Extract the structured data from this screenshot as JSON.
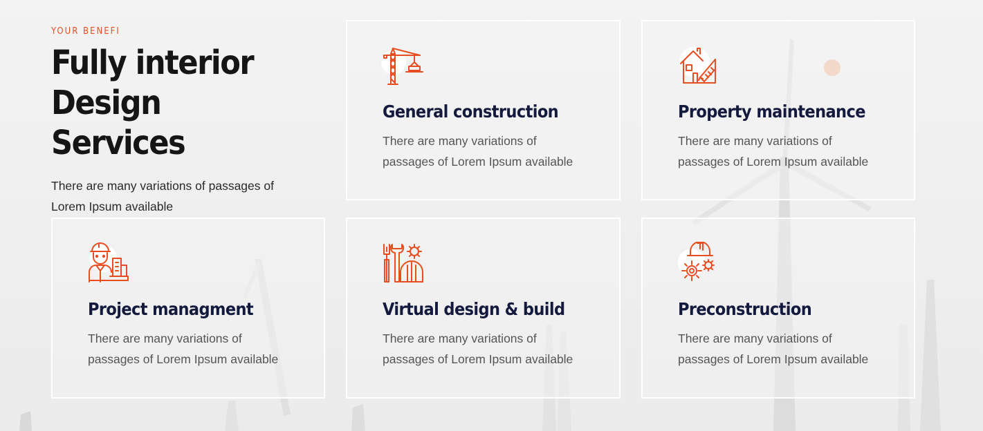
{
  "section": {
    "eyebrow": "YOUR BENEFI",
    "title_line1": "Fully interior",
    "title_line2": "Design Services",
    "description": "There are many variations of passages of Lorem Ipsum available"
  },
  "colors": {
    "accent": "#e84d1f",
    "title_dark": "#151515",
    "card_title": "#131a3d",
    "body_text": "#555555",
    "card_border": "#ffffff"
  },
  "services": [
    {
      "title": "General construction",
      "description": "There are many variations of passages of Lorem Ipsum available",
      "icon": "crane-icon"
    },
    {
      "title": "Property maintenance",
      "description": "There are many variations of passages of Lorem Ipsum available",
      "icon": "house-blueprint-icon"
    },
    {
      "title": "Project managment",
      "description": "There are many variations of passages of Lorem Ipsum available",
      "icon": "engineer-icon"
    },
    {
      "title": "Virtual design & build",
      "description": "There are many variations of passages of Lorem Ipsum available",
      "icon": "tools-helmet-icon"
    },
    {
      "title": "Preconstruction",
      "description": "There are many variations of passages of Lorem Ipsum available",
      "icon": "helmet-gears-icon"
    }
  ]
}
